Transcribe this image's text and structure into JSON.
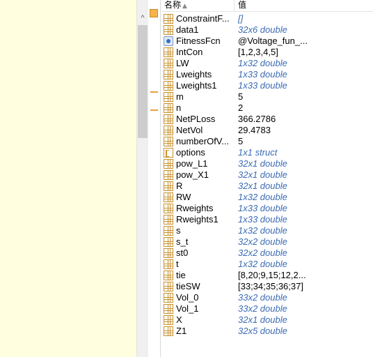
{
  "workspace": {
    "header": {
      "name_label": "名称",
      "sort_indicator": "▲",
      "value_label": "值"
    },
    "rows": [
      {
        "name": "ConstraintF...",
        "value": "[]",
        "icon": "grid-icon",
        "info": true
      },
      {
        "name": "data1",
        "value": "32x6 double",
        "icon": "grid-icon",
        "info": true
      },
      {
        "name": "FitnessFcn",
        "value": "@Voltage_fun_...",
        "icon": "function-handle-icon",
        "info": false
      },
      {
        "name": "IntCon",
        "value": "[1,2,3,4,5]",
        "icon": "grid-icon",
        "info": false
      },
      {
        "name": "LW",
        "value": "1x32 double",
        "icon": "grid-icon",
        "info": true
      },
      {
        "name": "Lweights",
        "value": "1x33 double",
        "icon": "grid-icon",
        "info": true
      },
      {
        "name": "Lweights1",
        "value": "1x33 double",
        "icon": "grid-icon",
        "info": true
      },
      {
        "name": "m",
        "value": "5",
        "icon": "grid-icon",
        "info": false
      },
      {
        "name": "n",
        "value": "2",
        "icon": "grid-icon",
        "info": false
      },
      {
        "name": "NetPLoss",
        "value": "366.2786",
        "icon": "grid-icon",
        "info": false
      },
      {
        "name": "NetVol",
        "value": "29.4783",
        "icon": "grid-icon",
        "info": false
      },
      {
        "name": "numberOfV...",
        "value": "5",
        "icon": "grid-icon",
        "info": false
      },
      {
        "name": "options",
        "value": "1x1 struct",
        "icon": "struct-icon",
        "info": true
      },
      {
        "name": "pow_L1",
        "value": "32x1 double",
        "icon": "grid-icon",
        "info": true
      },
      {
        "name": "pow_X1",
        "value": "32x1 double",
        "icon": "grid-icon",
        "info": true
      },
      {
        "name": "R",
        "value": "32x1 double",
        "icon": "grid-icon",
        "info": true
      },
      {
        "name": "RW",
        "value": "1x32 double",
        "icon": "grid-icon",
        "info": true
      },
      {
        "name": "Rweights",
        "value": "1x33 double",
        "icon": "grid-icon",
        "info": true
      },
      {
        "name": "Rweights1",
        "value": "1x33 double",
        "icon": "grid-icon",
        "info": true
      },
      {
        "name": "s",
        "value": "1x32 double",
        "icon": "grid-icon",
        "info": true
      },
      {
        "name": "s_t",
        "value": "32x2 double",
        "icon": "grid-icon",
        "info": true
      },
      {
        "name": "st0",
        "value": "32x2 double",
        "icon": "grid-icon",
        "info": true
      },
      {
        "name": "t",
        "value": "1x32 double",
        "icon": "grid-icon",
        "info": true
      },
      {
        "name": "tie",
        "value": "[8,20;9,15;12,2...",
        "icon": "grid-icon",
        "info": false
      },
      {
        "name": "tieSW",
        "value": "[33;34;35;36;37]",
        "icon": "grid-icon",
        "info": false
      },
      {
        "name": "Vol_0",
        "value": "33x2 double",
        "icon": "grid-icon",
        "info": true
      },
      {
        "name": "Vol_1",
        "value": "33x2 double",
        "icon": "grid-icon",
        "info": true
      },
      {
        "name": "X",
        "value": "32x1 double",
        "icon": "grid-icon",
        "info": true
      },
      {
        "name": "Z1",
        "value": "32x5 double",
        "icon": "grid-icon",
        "info": true
      }
    ]
  },
  "scrollbar": {
    "up_arrow": "^"
  },
  "colors": {
    "editor_background": "#ffffe0",
    "info_value": "#3b6bb5",
    "warning_marker": "#e8a13c"
  }
}
